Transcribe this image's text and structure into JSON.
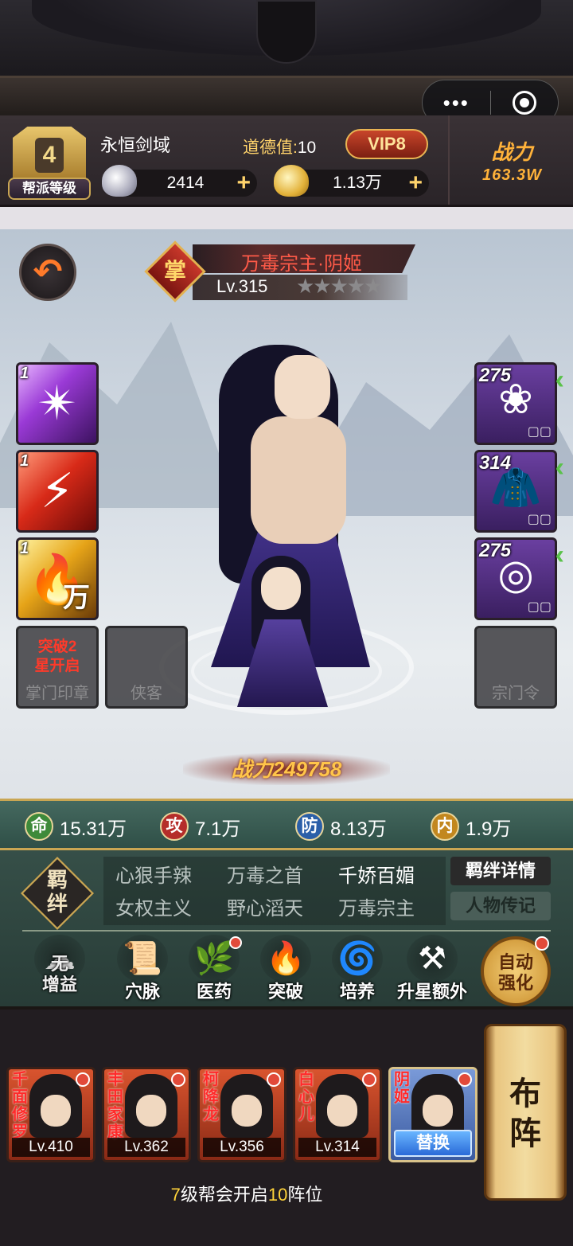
{
  "header": {
    "guild_level": "4",
    "guild_level_label": "帮派等级",
    "guild_name": "永恒剑域",
    "morality_label": "道德值:",
    "morality_value": "10",
    "vip": "VIP8",
    "silver": "2414",
    "gold": "1.13万",
    "plus": "+",
    "power_label": "战力",
    "power_value": "163.3W"
  },
  "capsule": {
    "more": "•••"
  },
  "hero_panel": {
    "rank_char": "掌",
    "name": "万毒宗主·阴姬",
    "level": "Lv.315",
    "stars": "★★★★★",
    "star_count": 5,
    "battle_power": "战力249758"
  },
  "skills": [
    {
      "count": "1",
      "icon": "shuriken-skill-icon"
    },
    {
      "count": "1",
      "icon": "red-claw-skill-icon"
    },
    {
      "count": "1",
      "icon": "golden-flame-skill-icon",
      "badge": "万"
    }
  ],
  "locked_slots": {
    "seal_msg": "突破2\n星开启",
    "seal_label": "掌门印章",
    "guest_label": "侠客",
    "token_label": "宗门令"
  },
  "equipment": [
    {
      "count": "275",
      "icon": "dart-flower-icon",
      "boxes": "▢▢"
    },
    {
      "count": "314",
      "icon": "fur-robe-icon",
      "boxes": "▢▢"
    },
    {
      "count": "275",
      "icon": "jade-pendant-icon",
      "boxes": "▢▢"
    }
  ],
  "stats": [
    {
      "icon_char": "命",
      "value": "15.31万"
    },
    {
      "icon_char": "攻",
      "value": "7.1万"
    },
    {
      "icon_char": "防",
      "value": "8.13万"
    },
    {
      "icon_char": "内",
      "value": "1.9万"
    }
  ],
  "bonds": {
    "icon_text": "羁绊",
    "items": [
      "心狠手辣",
      "万毒之首",
      "千娇百媚",
      "女权主义",
      "野心滔天",
      "万毒宗主"
    ],
    "details_button": "羁绊详情",
    "biography_button": "人物传记"
  },
  "actions": {
    "no_buff": "无增益",
    "acupoint": "穴脉",
    "medicine": "医药",
    "breakthrough": "突破",
    "cultivate": "培养",
    "star_extra": "升星额外",
    "auto_enhance": "自动强化"
  },
  "roster": [
    {
      "name": "千面修罗",
      "level": "Lv.410"
    },
    {
      "name": "丰田家康",
      "level": "Lv.362"
    },
    {
      "name": "柯降龙",
      "level": "Lv.356"
    },
    {
      "name": "白心儿",
      "level": "Lv.314"
    },
    {
      "name": "阴姬",
      "swap": "替换"
    }
  ],
  "formation_button": "布阵",
  "tip": {
    "a": "7",
    "b": "级帮会开启",
    "c": "10",
    "d": "阵位"
  }
}
